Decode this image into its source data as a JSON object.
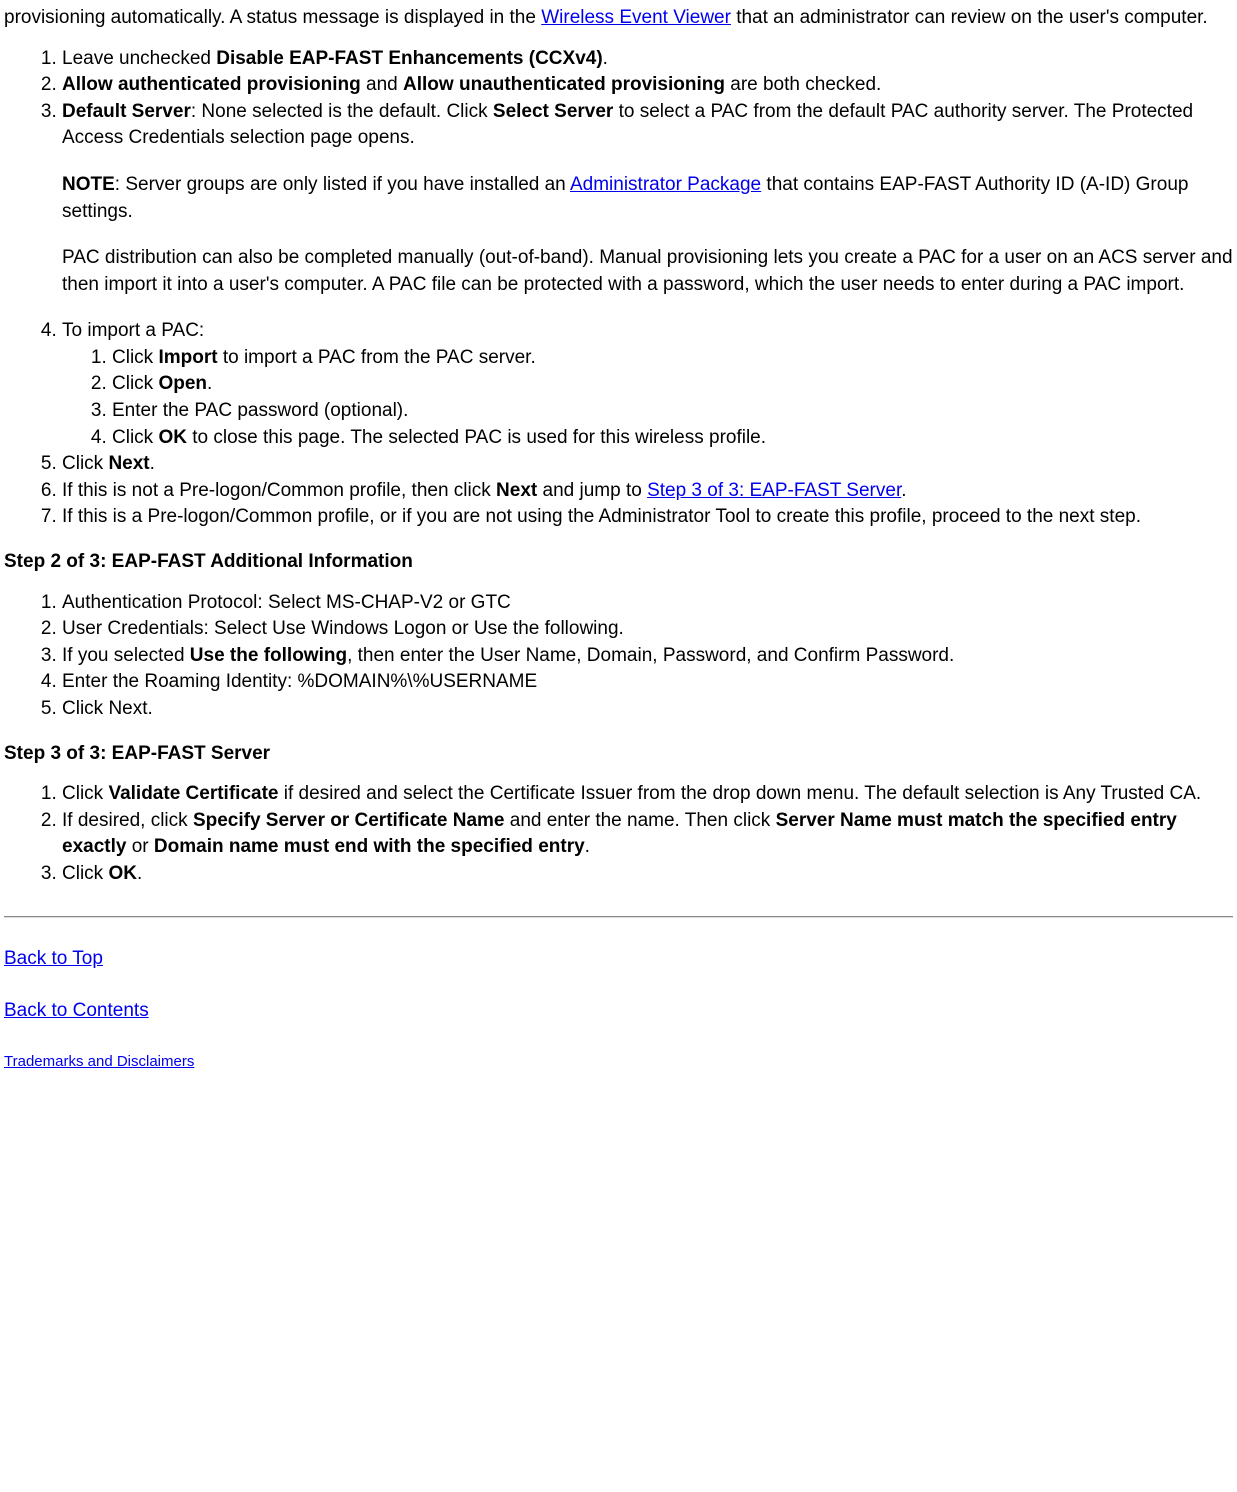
{
  "intro": {
    "pre": "provisioning automatically. A status message is displayed in the ",
    "link": "Wireless Event Viewer",
    "post": " that an administrator can review on the user's computer."
  },
  "list1": {
    "i1_pre": "Leave unchecked ",
    "i1_bold": "Disable EAP-FAST Enhancements (CCXv4)",
    "i1_post": ".",
    "i2_bold1": "Allow authenticated provisioning",
    "i2_mid": " and ",
    "i2_bold2": "Allow unauthenticated provisioning",
    "i2_post": " are both checked.",
    "i3_bold1": "Default Server",
    "i3_mid1": ": None selected is the default. Click ",
    "i3_bold2": "Select Server",
    "i3_mid2": " to select a PAC from the default PAC authority server. The Protected Access Credentials selection page opens.",
    "i3_note_bold": "NOTE",
    "i3_note_mid": ": Server groups are only listed if you have installed an ",
    "i3_note_link": "Administrator Package",
    "i3_note_post": " that contains EAP-FAST Authority ID (A-ID) Group settings.",
    "i3_para2": "PAC distribution can also be completed manually (out-of-band). Manual provisioning lets you create a PAC for a user on an ACS server and then import it into a user's computer. A PAC file can be protected with a password, which the user needs to enter during a PAC import.",
    "i4_title": "To import a PAC:",
    "i4_sub1_pre": "Click ",
    "i4_sub1_bold": "Import",
    "i4_sub1_post": " to import a PAC from the PAC server.",
    "i4_sub2_pre": "Click ",
    "i4_sub2_bold": "Open",
    "i4_sub2_post": ".",
    "i4_sub3": "Enter the PAC password (optional).",
    "i4_sub4_pre": "Click ",
    "i4_sub4_bold": "OK",
    "i4_sub4_post": " to close this page. The selected PAC is used for this wireless profile.",
    "i5_pre": "Click ",
    "i5_bold": "Next",
    "i5_post": ".",
    "i6_pre": "If this is not a Pre-logon/Common profile, then click ",
    "i6_bold": "Next",
    "i6_mid": " and jump to ",
    "i6_link": "Step 3 of 3: EAP-FAST Server",
    "i6_post": ".",
    "i7": "If this is a Pre-logon/Common profile, or if you are not using the Administrator Tool to create this profile, proceed to the next step."
  },
  "step2": {
    "heading": "Step 2 of 3: EAP-FAST Additional Information",
    "i1": "Authentication Protocol: Select MS-CHAP-V2 or GTC",
    "i2": "User Credentials: Select Use Windows Logon or Use the following.",
    "i3_pre": "If you selected ",
    "i3_bold": "Use the following",
    "i3_post": ", then enter the User Name, Domain, Password, and Confirm Password.",
    "i4": "Enter the Roaming Identity: %DOMAIN%\\%USERNAME",
    "i5": "Click Next."
  },
  "step3": {
    "heading": "Step 3 of 3: EAP-FAST Server",
    "i1_pre": "Click ",
    "i1_bold": "Validate Certificate",
    "i1_post": " if desired and select the Certificate Issuer from the drop down menu. The default selection is Any Trusted CA.",
    "i2_pre": "If desired, click ",
    "i2_bold1": "Specify Server or Certificate Name",
    "i2_mid1": " and enter the name. Then click ",
    "i2_bold2": "Server Name must match the specified entry exactly",
    "i2_mid2": " or ",
    "i2_bold3": "Domain name must end with the specified entry",
    "i2_post": ".",
    "i3_pre": "Click ",
    "i3_bold": "OK",
    "i3_post": "."
  },
  "footer": {
    "back_top": "Back to Top",
    "back_contents": "Back to Contents",
    "trademarks": "Trademarks and Disclaimers"
  }
}
